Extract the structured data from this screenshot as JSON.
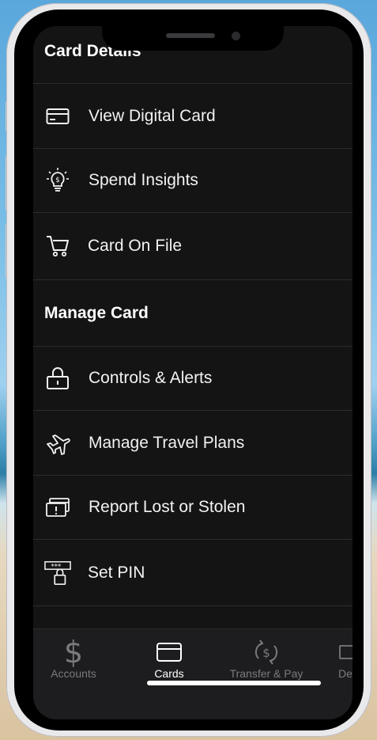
{
  "sections": {
    "card_details": "Card Details",
    "manage_card": "Manage Card"
  },
  "items": {
    "view_digital_card": "View Digital Card",
    "spend_insights": "Spend Insights",
    "card_on_file": "Card On File",
    "controls_alerts": "Controls & Alerts",
    "manage_travel_plans": "Manage Travel Plans",
    "report_lost": "Report Lost or Stolen",
    "set_pin": "Set PIN"
  },
  "tabs": {
    "accounts": "Accounts",
    "cards": "Cards",
    "transfer_pay": "Transfer & Pay",
    "partial": "De"
  },
  "colors": {
    "background": "#141414",
    "text": "#f2f2f2",
    "tab_inactive": "#7a7a7d",
    "tab_active": "#ffffff"
  }
}
